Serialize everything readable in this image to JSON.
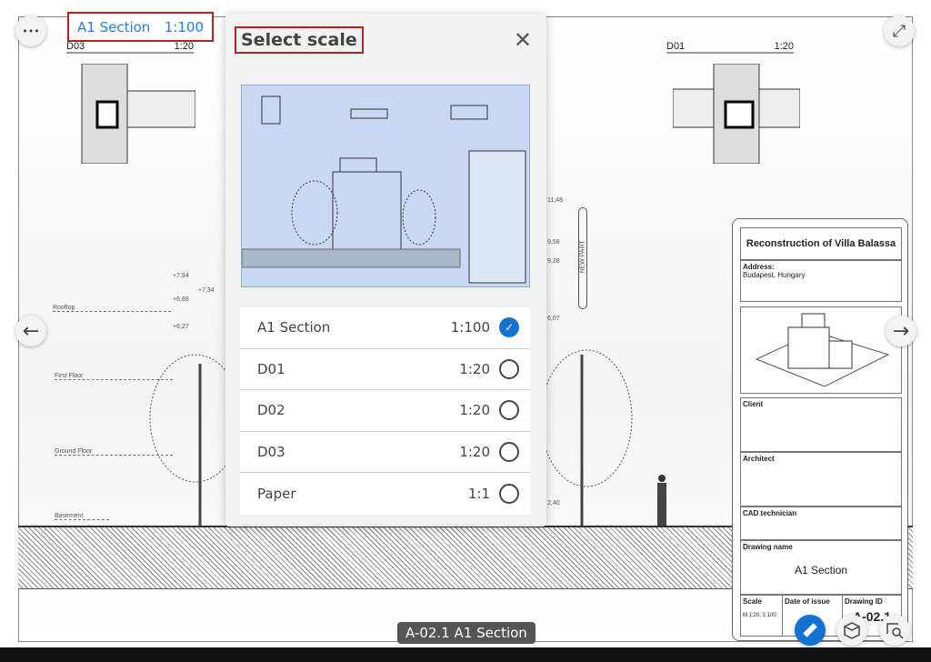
{
  "header": {
    "view_name": "A1 Section",
    "view_scale": "1:100"
  },
  "drawing": {
    "details": [
      {
        "name": "D03",
        "scale": "1:20"
      },
      {
        "name": "D01",
        "scale": "1:20"
      }
    ],
    "levels": [
      "Rooftop",
      "First Floor",
      "Ground Floor",
      "Basement"
    ],
    "elevations_left": [
      "+7,94",
      "+7,34",
      "+6,88",
      "+6,27"
    ],
    "elevations_right": [
      "11,48",
      "9,58",
      "9,28",
      "6,07",
      "2,40"
    ],
    "new_part_label": "NEW PART"
  },
  "title_block": {
    "project": "Reconstruction of Villa Balassa",
    "address_label": "Address:",
    "address": "Budapest, Hungary",
    "client_label": "Client",
    "architect_label": "Architect",
    "cad_label": "CAD technician",
    "drawing_name_label": "Drawing name",
    "drawing_name": "A1 Section",
    "scale_label": "Scale",
    "scale_value": "M 1:20, 1:100",
    "date_label": "Date of issue",
    "id_label": "Drawing ID",
    "id_value": "A-02.1"
  },
  "popup": {
    "title": "Select scale",
    "options": [
      {
        "name": "A1 Section",
        "scale": "1:100",
        "selected": true
      },
      {
        "name": "D01",
        "scale": "1:20",
        "selected": false
      },
      {
        "name": "D02",
        "scale": "1:20",
        "selected": false
      },
      {
        "name": "D03",
        "scale": "1:20",
        "selected": false
      },
      {
        "name": "Paper",
        "scale": "1:1",
        "selected": false
      }
    ],
    "check": "✓"
  },
  "tooltip": "A-02.1 A1 Section",
  "icons": {
    "more": "•••",
    "close": "✕",
    "prev": "←",
    "next": "→",
    "expand": "⤢"
  },
  "colors": {
    "accent": "#1473d0",
    "highlight_border": "#b22222"
  }
}
